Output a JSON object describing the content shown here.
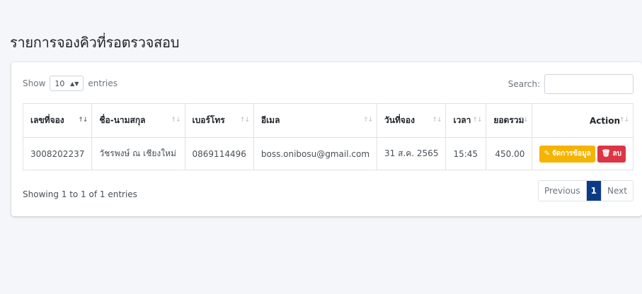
{
  "page": {
    "title": "รายการจองคิวที่รอตรวจสอบ"
  },
  "table_controls": {
    "show_label": "Show",
    "entries_count": "10",
    "entries_label": "entries",
    "search_label": "Search:",
    "search_value": ""
  },
  "table": {
    "columns": [
      "เลขที่จอง",
      "ชื่อ-นามสกุล",
      "เบอร์โทร",
      "อีเมล",
      "วันที่จอง",
      "เวลา",
      "ยอดรวม",
      "Action"
    ],
    "rows": [
      {
        "booking_no": "3008202237",
        "name": "วัชรพงษ์ ณ เชียงใหม่",
        "phone": "0869114496",
        "email": "boss.onibosu@gmail.com",
        "date": "31 ส.ค. 2565",
        "time": "15:45",
        "total": "450.00",
        "edit_label": "จัดการข้อมูล",
        "delete_label": "ลบ"
      }
    ]
  },
  "footer": {
    "info": "Showing 1 to 1 of 1 entries",
    "pagination": {
      "previous": "Previous",
      "current": "1",
      "next": "Next"
    }
  },
  "colors": {
    "edit_button": "#f4b400",
    "delete_button": "#dc3545",
    "active_page": "#0b3b86"
  },
  "icons": {
    "edit": "edit-icon",
    "delete": "trash-icon",
    "sort": "sort-icon",
    "select": "select-arrows-icon"
  }
}
